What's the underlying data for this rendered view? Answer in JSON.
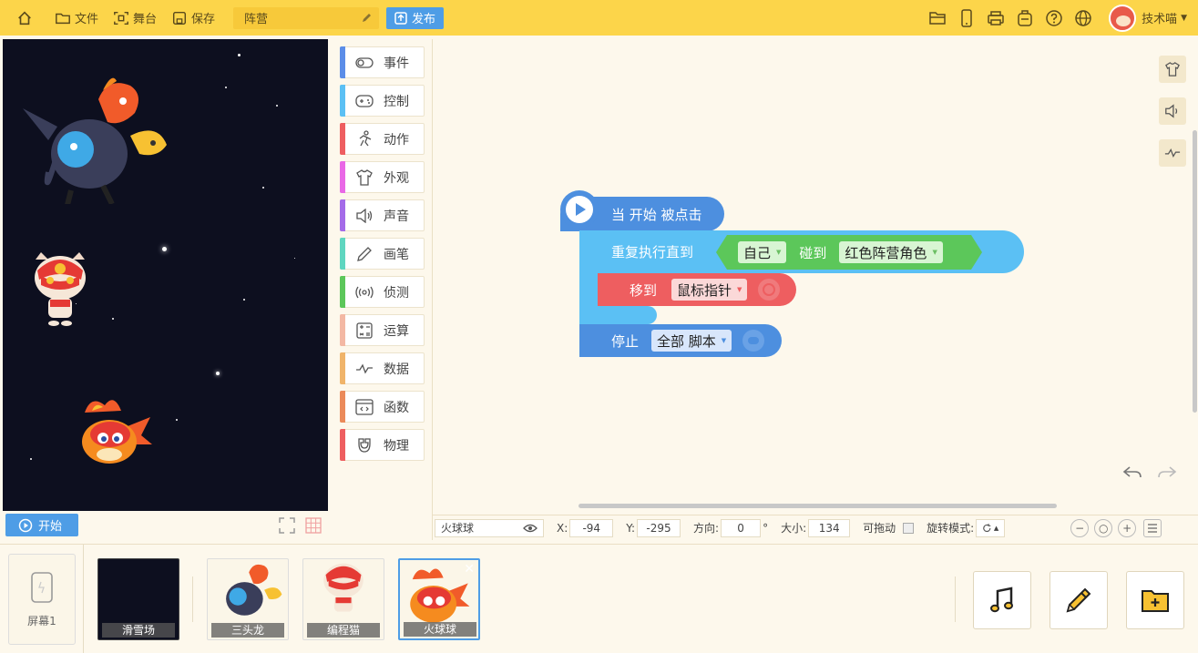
{
  "topbar": {
    "home_icon": "home-icon",
    "file_label": "文件",
    "stage_label": "舞台",
    "save_label": "保存",
    "project_name": "阵营",
    "publish_label": "发布",
    "user_name": "技术喵"
  },
  "stage": {
    "start_label": "开始"
  },
  "categories": [
    {
      "label": "事件",
      "color": "#5b8de8",
      "icon": "toggle-icon"
    },
    {
      "label": "控制",
      "color": "#5bc0f4",
      "icon": "gamepad-icon"
    },
    {
      "label": "动作",
      "color": "#ee5e60",
      "icon": "runner-icon"
    },
    {
      "label": "外观",
      "color": "#e968e6",
      "icon": "shirt-icon"
    },
    {
      "label": "声音",
      "color": "#a46be8",
      "icon": "speaker-icon"
    },
    {
      "label": "画笔",
      "color": "#5fd6c0",
      "icon": "pencil-icon"
    },
    {
      "label": "侦测",
      "color": "#5cc75a",
      "icon": "radar-icon"
    },
    {
      "label": "运算",
      "color": "#f3b8a4",
      "icon": "calculator-icon"
    },
    {
      "label": "数据",
      "color": "#f0b46a",
      "icon": "data-icon"
    },
    {
      "label": "函数",
      "color": "#eb8a5a",
      "icon": "function-icon"
    },
    {
      "label": "物理",
      "color": "#ee5e60",
      "icon": "magnet-icon"
    }
  ],
  "blocks": {
    "hat_text": "当 开始 被点击",
    "repeat_text": "重复执行直到",
    "self_value": "自己",
    "touch_text": "碰到",
    "target_value": "红色阵营角色",
    "move_text": "移到",
    "move_target": "鼠标指针",
    "stop_text": "停止",
    "stop_value": "全部 脚本"
  },
  "props": {
    "sprite_name": "火球球",
    "x_label": "X:",
    "x_value": "-94",
    "y_label": "Y:",
    "y_value": "-295",
    "dir_label": "方向:",
    "dir_value": "0",
    "dir_unit": "°",
    "size_label": "大小:",
    "size_value": "134",
    "drag_label": "可拖动",
    "rotate_label": "旋转模式:"
  },
  "bottom": {
    "screen_label": "屏幕1",
    "thumbs": [
      {
        "label": "滑雪场"
      },
      {
        "label": "三头龙"
      },
      {
        "label": "编程猫"
      },
      {
        "label": "火球球"
      }
    ]
  }
}
